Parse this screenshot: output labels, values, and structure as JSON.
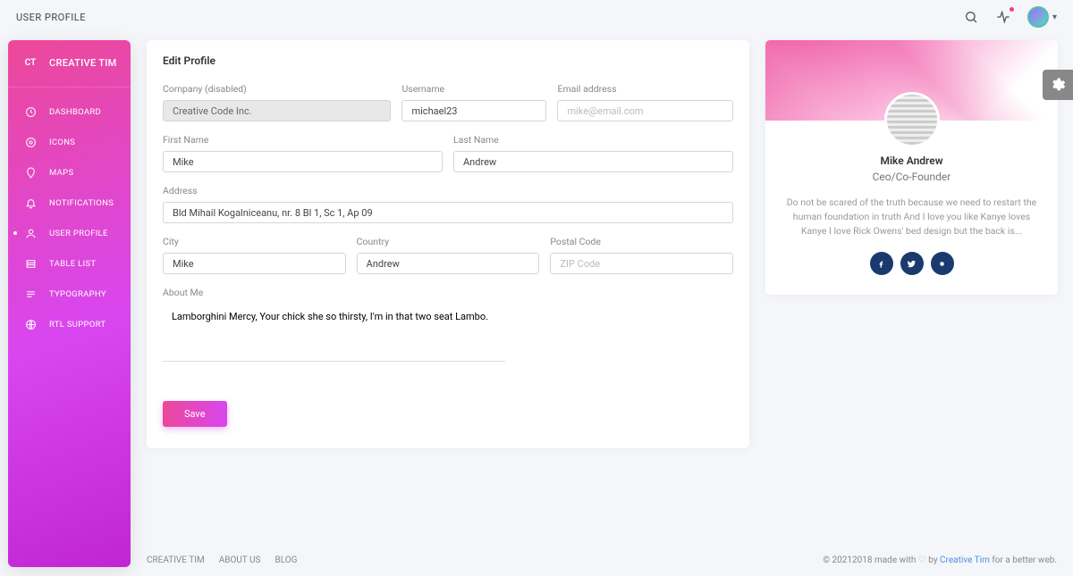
{
  "page_title": "USER PROFILE",
  "brand": {
    "badge": "CT",
    "name": "CREATIVE TIM"
  },
  "sidebar": {
    "items": [
      {
        "label": "DASHBOARD",
        "icon": "dashboard"
      },
      {
        "label": "ICONS",
        "icon": "icons"
      },
      {
        "label": "MAPS",
        "icon": "maps"
      },
      {
        "label": "NOTIFICATIONS",
        "icon": "bell"
      },
      {
        "label": "USER PROFILE",
        "icon": "user",
        "active": true
      },
      {
        "label": "TABLE LIST",
        "icon": "table"
      },
      {
        "label": "TYPOGRAPHY",
        "icon": "typo"
      },
      {
        "label": "RTL SUPPORT",
        "icon": "globe"
      }
    ]
  },
  "form": {
    "title": "Edit Profile",
    "company": {
      "label": "Company (disabled)",
      "value": "Creative Code Inc."
    },
    "username": {
      "label": "Username",
      "value": "michael23"
    },
    "email": {
      "label": "Email address",
      "placeholder": "mike@email.com"
    },
    "first_name": {
      "label": "First Name",
      "value": "Mike"
    },
    "last_name": {
      "label": "Last Name",
      "value": "Andrew"
    },
    "address": {
      "label": "Address",
      "value": "Bld Mihail Kogalniceanu, nr. 8 Bl 1, Sc 1, Ap 09"
    },
    "city": {
      "label": "City",
      "value": "Mike"
    },
    "country": {
      "label": "Country",
      "value": "Andrew"
    },
    "postal": {
      "label": "Postal Code",
      "placeholder": "ZIP Code"
    },
    "about": {
      "label": "About Me",
      "value": "Lamborghini Mercy, Your chick she so thirsty, I'm in that two seat Lambo."
    },
    "save": "Save"
  },
  "profile": {
    "name": "Mike Andrew",
    "role": "Ceo/Co-Founder",
    "desc": "Do not be scared of the truth because we need to restart the human foundation in truth And I love you like Kanye loves Kanye I love Rick Owens' bed design but the back is..."
  },
  "footer": {
    "links": [
      "CREATIVE TIM",
      "ABOUT US",
      "BLOG"
    ],
    "copyright_prefix": "© 20212018 made with ",
    "by": " by ",
    "ct": "Creative Tim",
    "suffix": " for a better web."
  }
}
